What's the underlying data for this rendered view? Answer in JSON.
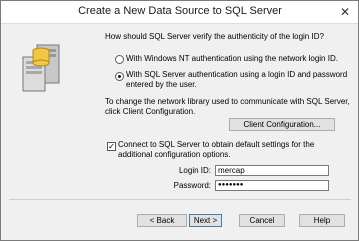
{
  "window": {
    "title": "Create a New Data Source to SQL Server"
  },
  "question": "How should SQL Server verify the authenticity of the login ID?",
  "auth_options": [
    {
      "label": "With Windows NT authentication using the network login ID.",
      "selected": false
    },
    {
      "label_line1": "With SQL Server authentication using a login ID and password",
      "label_line2": "entered by the user.",
      "selected": true
    }
  ],
  "network_text": {
    "line1": "To change the network library used to communicate with SQL Server,",
    "line2": "click Client Configuration."
  },
  "client_config_label": "Client Configuration...",
  "connect_option": {
    "line1": "Connect to SQL Server to obtain default settings for the",
    "line2": "additional configuration options.",
    "checked": true
  },
  "login": {
    "label": "Login ID:",
    "value": "mercap"
  },
  "password": {
    "label": "Password:",
    "value": "●●●●●●●"
  },
  "buttons": {
    "back": "< Back",
    "next": "Next >",
    "cancel": "Cancel",
    "help": "Help"
  }
}
